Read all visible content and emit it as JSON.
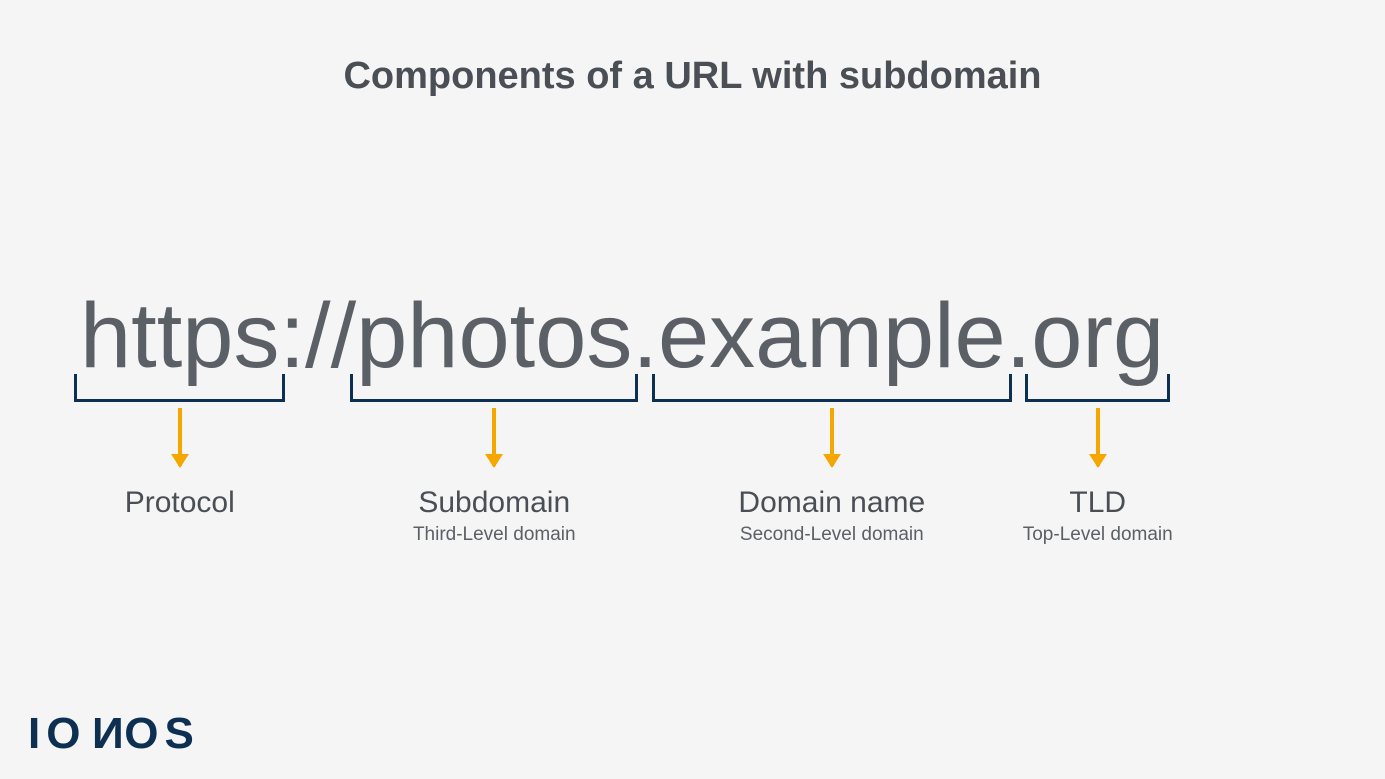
{
  "diagram": {
    "title": "Components of a URL with subdomain",
    "url_parts": {
      "protocol": "https",
      "sep1": "://",
      "subdomain": "photos",
      "sep2": ".",
      "domain": "example",
      "sep3": ".",
      "tld": "org"
    },
    "annotations": [
      {
        "id": "protocol",
        "label": "Protocol",
        "sublabel": ""
      },
      {
        "id": "subdomain",
        "label": "Subdomain",
        "sublabel": "Third-Level domain"
      },
      {
        "id": "domain",
        "label": "Domain name",
        "sublabel": "Second-Level domain"
      },
      {
        "id": "tld",
        "label": "TLD",
        "sublabel": "Top-Level domain"
      }
    ],
    "colors": {
      "bracket": "#0d3052",
      "arrow": "#f5a700",
      "text": "#4a4f55",
      "url_text": "#5b6066",
      "background": "#f5f5f5"
    }
  },
  "branding": {
    "logo_text": "IONOS"
  }
}
